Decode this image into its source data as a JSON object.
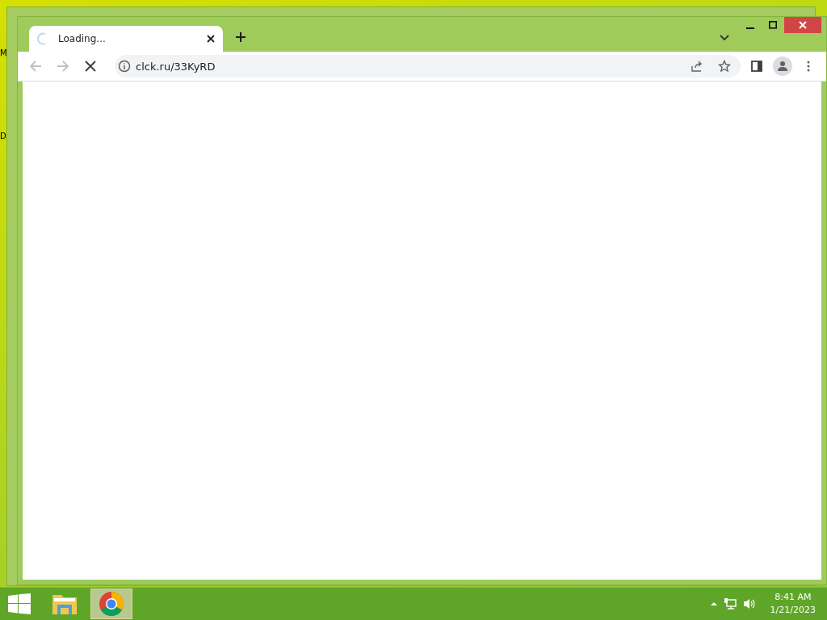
{
  "desktop_labels": [
    "M",
    "D"
  ],
  "browser": {
    "tab": {
      "title": "Loading...",
      "loading": true
    },
    "toolbar": {
      "back_disabled": true,
      "forward_disabled": true,
      "url": "clck.ru/33KyRD"
    }
  },
  "taskbar": {
    "apps": [
      {
        "kind": "explorer",
        "selected": false
      },
      {
        "kind": "chrome",
        "selected": true
      }
    ],
    "time": "8:41 AM",
    "date": "1/21/2023"
  }
}
